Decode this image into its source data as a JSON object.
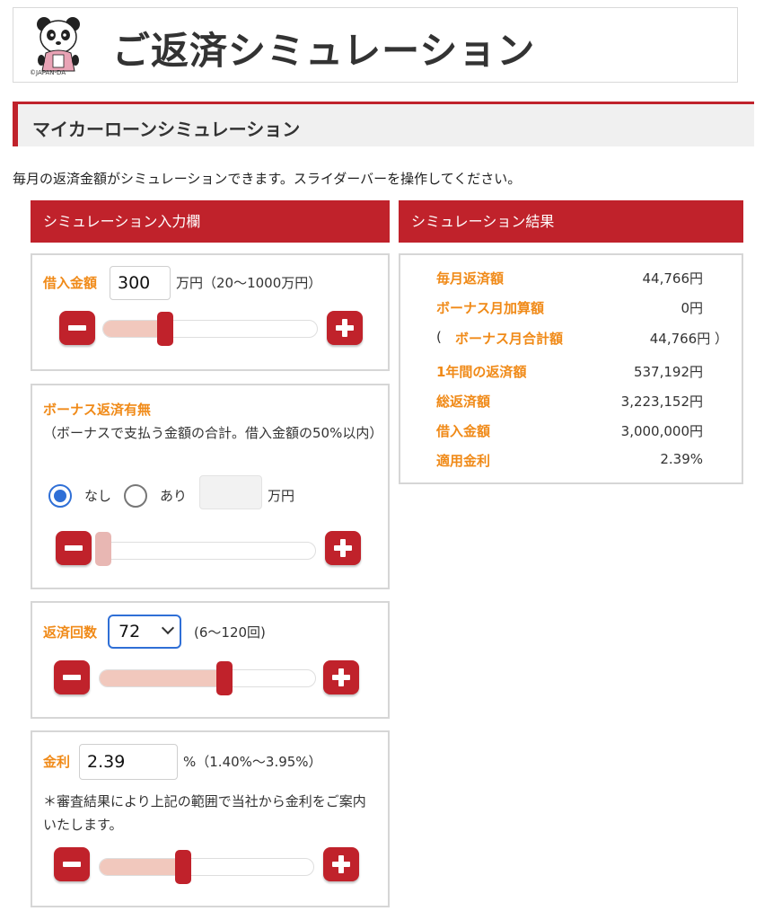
{
  "header": {
    "title": "ご返済シミュレーション",
    "logo_caption": "©JAPAN-DA"
  },
  "section": {
    "title": "マイカーローンシミュレーション"
  },
  "intro": "毎月の返済金額がシミュレーションできます。スライダーバーを操作してください。",
  "input_panel": {
    "title": "シミュレーション入力欄",
    "loan": {
      "label": "借入金額",
      "value": "300",
      "unit_range": "万円（20〜1000万円）",
      "slider_fraction": 0.29
    },
    "bonus": {
      "label": "ボーナス返済有無",
      "note": "（ボーナスで支払う金額の合計。借入金額の50%以内）",
      "option_none": "なし",
      "option_yes": "あり",
      "selected": "なし",
      "amount_value": "",
      "amount_unit": "万円",
      "slider_fraction": 0.0
    },
    "count": {
      "label": "返済回数",
      "selected": "72",
      "range": "(6〜120回)",
      "slider_fraction": 0.58
    },
    "rate": {
      "label": "金利",
      "value": "2.39",
      "unit_range": "%（1.40%〜3.95%）",
      "note": "＊審査結果により上記の範囲で当社から金利をご案内いたします。",
      "slider_fraction": 0.39
    }
  },
  "result_panel": {
    "title": "シミュレーション結果",
    "rows": [
      {
        "label": "毎月返済額",
        "value": "44,766円"
      },
      {
        "label": "ボーナス月加算額",
        "value": "0円"
      },
      {
        "label": "ボーナス月合計額",
        "value": "44,766円 ）",
        "open_paren": "("
      },
      {
        "label": "1年間の返済額",
        "value": "537,192円"
      },
      {
        "label": "総返済額",
        "value": "3,223,152円"
      },
      {
        "label": "借入金額",
        "value": "3,000,000円"
      },
      {
        "label": "適用金利",
        "value": "2.39%"
      }
    ]
  },
  "colors": {
    "accent_red": "#c0222b",
    "label_orange": "#f08a18",
    "slider_fill": "#f1c8bd",
    "radio_blue": "#2f6fd6"
  },
  "icons": {
    "minus": "minus-icon",
    "plus": "plus-icon",
    "logo": "panda-mascot-logo"
  }
}
